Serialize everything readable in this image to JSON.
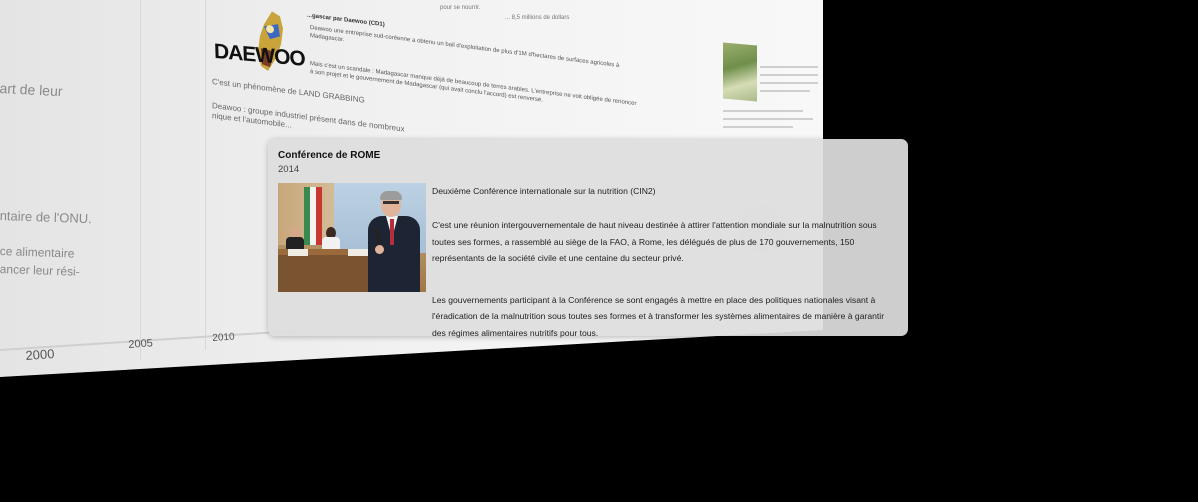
{
  "background": {
    "left_texts": [
      "art de leur",
      "ntaire de l'ONU.",
      "ce alimentaire",
      "ancer leur rési-"
    ],
    "axis_years": [
      "2000",
      "2005",
      "2010"
    ],
    "article": {
      "heading": "...gascar par Daewoo (CD1)",
      "lines": [
        "Deawoo une entreprise sud-coréenne a obtenu un bail d'exploitation de plus d'1M d'hectares de surfaces agricoles à",
        "Madagascar.",
        "Mais c'est un scandale : Madagascar manque déjà de beaucoup de terres arables. L'entreprise ne voit obligée de renoncer",
        "à son projet et le gouvernement de Madagascar (qui avait conclu l'accord) est renversé.",
        "C'est un phénomène de LAND GRABBING",
        "Deawoo : groupe industriel présent dans de nombreux",
        "nique et l'automobile..."
      ],
      "logo_text": "DAEWOO",
      "top_right_lines": [
        "pour se nourrir.",
        "... 8,5 millions de dollars"
      ]
    }
  },
  "popup": {
    "title": "Conférence de ROME",
    "year": "2014",
    "image_alt": "photo-speaker-at-podium",
    "subtitle": "Deuxième Conférence internationale sur la nutrition (CIN2)",
    "paragraph1": "C'est une réunion intergouvernementale de haut niveau destinée à attirer l'attention mondiale sur la malnutrition sous toutes ses formes, a rassemblé au siège de la FAO, à Rome, les délégués de plus de 170 gouvernements, 150 représentants de la société civile et une centaine du secteur privé.",
    "paragraph2": "Les gouvernements participant à la Conférence se sont engagés à mettre en place des politiques nationales visant à l'éradication de la malnutrition sous toutes ses formes et à transformer les systèmes alimentaires de manière à garantir des régimes alimentaires nutritifs pour tous."
  },
  "colors": {
    "background": "#000000",
    "popup_bg": "#dedede",
    "text": "#222222"
  }
}
